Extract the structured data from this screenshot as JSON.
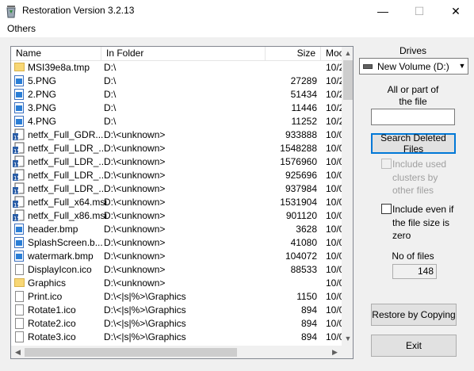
{
  "window": {
    "title": "Restoration Version 3.2.13",
    "minimize_glyph": "—",
    "maximize_glyph": "☐",
    "close_glyph": "✕"
  },
  "menu": {
    "others": "Others"
  },
  "list": {
    "columns": {
      "name": "Name",
      "folder": "In Folder",
      "size": "Size",
      "modified": "Moc"
    },
    "rows": [
      {
        "icon": "folder-icon",
        "name": "MSI39e8a.tmp",
        "folder": "D:\\",
        "size": "",
        "modified": "10/2"
      },
      {
        "icon": "image-file-icon",
        "name": "5.PNG",
        "folder": "D:\\",
        "size": "27289",
        "modified": "10/2"
      },
      {
        "icon": "image-file-icon",
        "name": "2.PNG",
        "folder": "D:\\",
        "size": "51434",
        "modified": "10/2"
      },
      {
        "icon": "image-file-icon",
        "name": "3.PNG",
        "folder": "D:\\",
        "size": "11446",
        "modified": "10/2"
      },
      {
        "icon": "image-file-icon",
        "name": "4.PNG",
        "folder": "D:\\",
        "size": "11252",
        "modified": "10/2"
      },
      {
        "icon": "msi-installer-icon",
        "name": "netfx_Full_GDR...",
        "folder": "D:\\<unknown>",
        "size": "933888",
        "modified": "10/0"
      },
      {
        "icon": "msi-installer-icon",
        "name": "netfx_Full_LDR_...",
        "folder": "D:\\<unknown>",
        "size": "1548288",
        "modified": "10/0"
      },
      {
        "icon": "msi-installer-icon",
        "name": "netfx_Full_LDR_...",
        "folder": "D:\\<unknown>",
        "size": "1576960",
        "modified": "10/0"
      },
      {
        "icon": "msi-installer-icon",
        "name": "netfx_Full_LDR_...",
        "folder": "D:\\<unknown>",
        "size": "925696",
        "modified": "10/0"
      },
      {
        "icon": "msi-installer-icon",
        "name": "netfx_Full_LDR_...",
        "folder": "D:\\<unknown>",
        "size": "937984",
        "modified": "10/0"
      },
      {
        "icon": "msi-installer-icon",
        "name": "netfx_Full_x64.msi",
        "folder": "D:\\<unknown>",
        "size": "1531904",
        "modified": "10/0"
      },
      {
        "icon": "msi-installer-icon",
        "name": "netfx_Full_x86.msi",
        "folder": "D:\\<unknown>",
        "size": "901120",
        "modified": "10/0"
      },
      {
        "icon": "image-file-icon",
        "name": "header.bmp",
        "folder": "D:\\<unknown>",
        "size": "3628",
        "modified": "10/0"
      },
      {
        "icon": "image-file-icon",
        "name": "SplashScreen.b...",
        "folder": "D:\\<unknown>",
        "size": "41080",
        "modified": "10/0"
      },
      {
        "icon": "image-file-icon",
        "name": "watermark.bmp",
        "folder": "D:\\<unknown>",
        "size": "104072",
        "modified": "10/0"
      },
      {
        "icon": "document-icon",
        "name": "DisplayIcon.ico",
        "folder": "D:\\<unknown>",
        "size": "88533",
        "modified": "10/0"
      },
      {
        "icon": "folder-icon",
        "name": "Graphics",
        "folder": "D:\\<unknown>",
        "size": "",
        "modified": "10/0"
      },
      {
        "icon": "document-icon",
        "name": "Print.ico",
        "folder": "D:\\<|s|%>\\Graphics",
        "size": "1150",
        "modified": "10/0"
      },
      {
        "icon": "document-icon",
        "name": "Rotate1.ico",
        "folder": "D:\\<|s|%>\\Graphics",
        "size": "894",
        "modified": "10/0"
      },
      {
        "icon": "document-icon",
        "name": "Rotate2.ico",
        "folder": "D:\\<|s|%>\\Graphics",
        "size": "894",
        "modified": "10/0"
      },
      {
        "icon": "document-icon",
        "name": "Rotate3.ico",
        "folder": "D:\\<|s|%>\\Graphics",
        "size": "894",
        "modified": "10/0"
      }
    ]
  },
  "side": {
    "drives_label": "Drives",
    "drive_value": "New Volume (D:)",
    "file_label_line1": "All or part of",
    "file_label_line2": "the file",
    "file_value": "",
    "search_button": "Search Deleted Files",
    "include_used_line1": "Include used",
    "include_used_line2": "clusters by",
    "include_used_line3": "other files",
    "include_zero_line1": "Include even if",
    "include_zero_line2": "the file size is",
    "include_zero_line3": "zero",
    "no_of_files_label": "No of files",
    "no_of_files_value": "148",
    "restore_button": "Restore by Copying",
    "exit_button": "Exit"
  }
}
